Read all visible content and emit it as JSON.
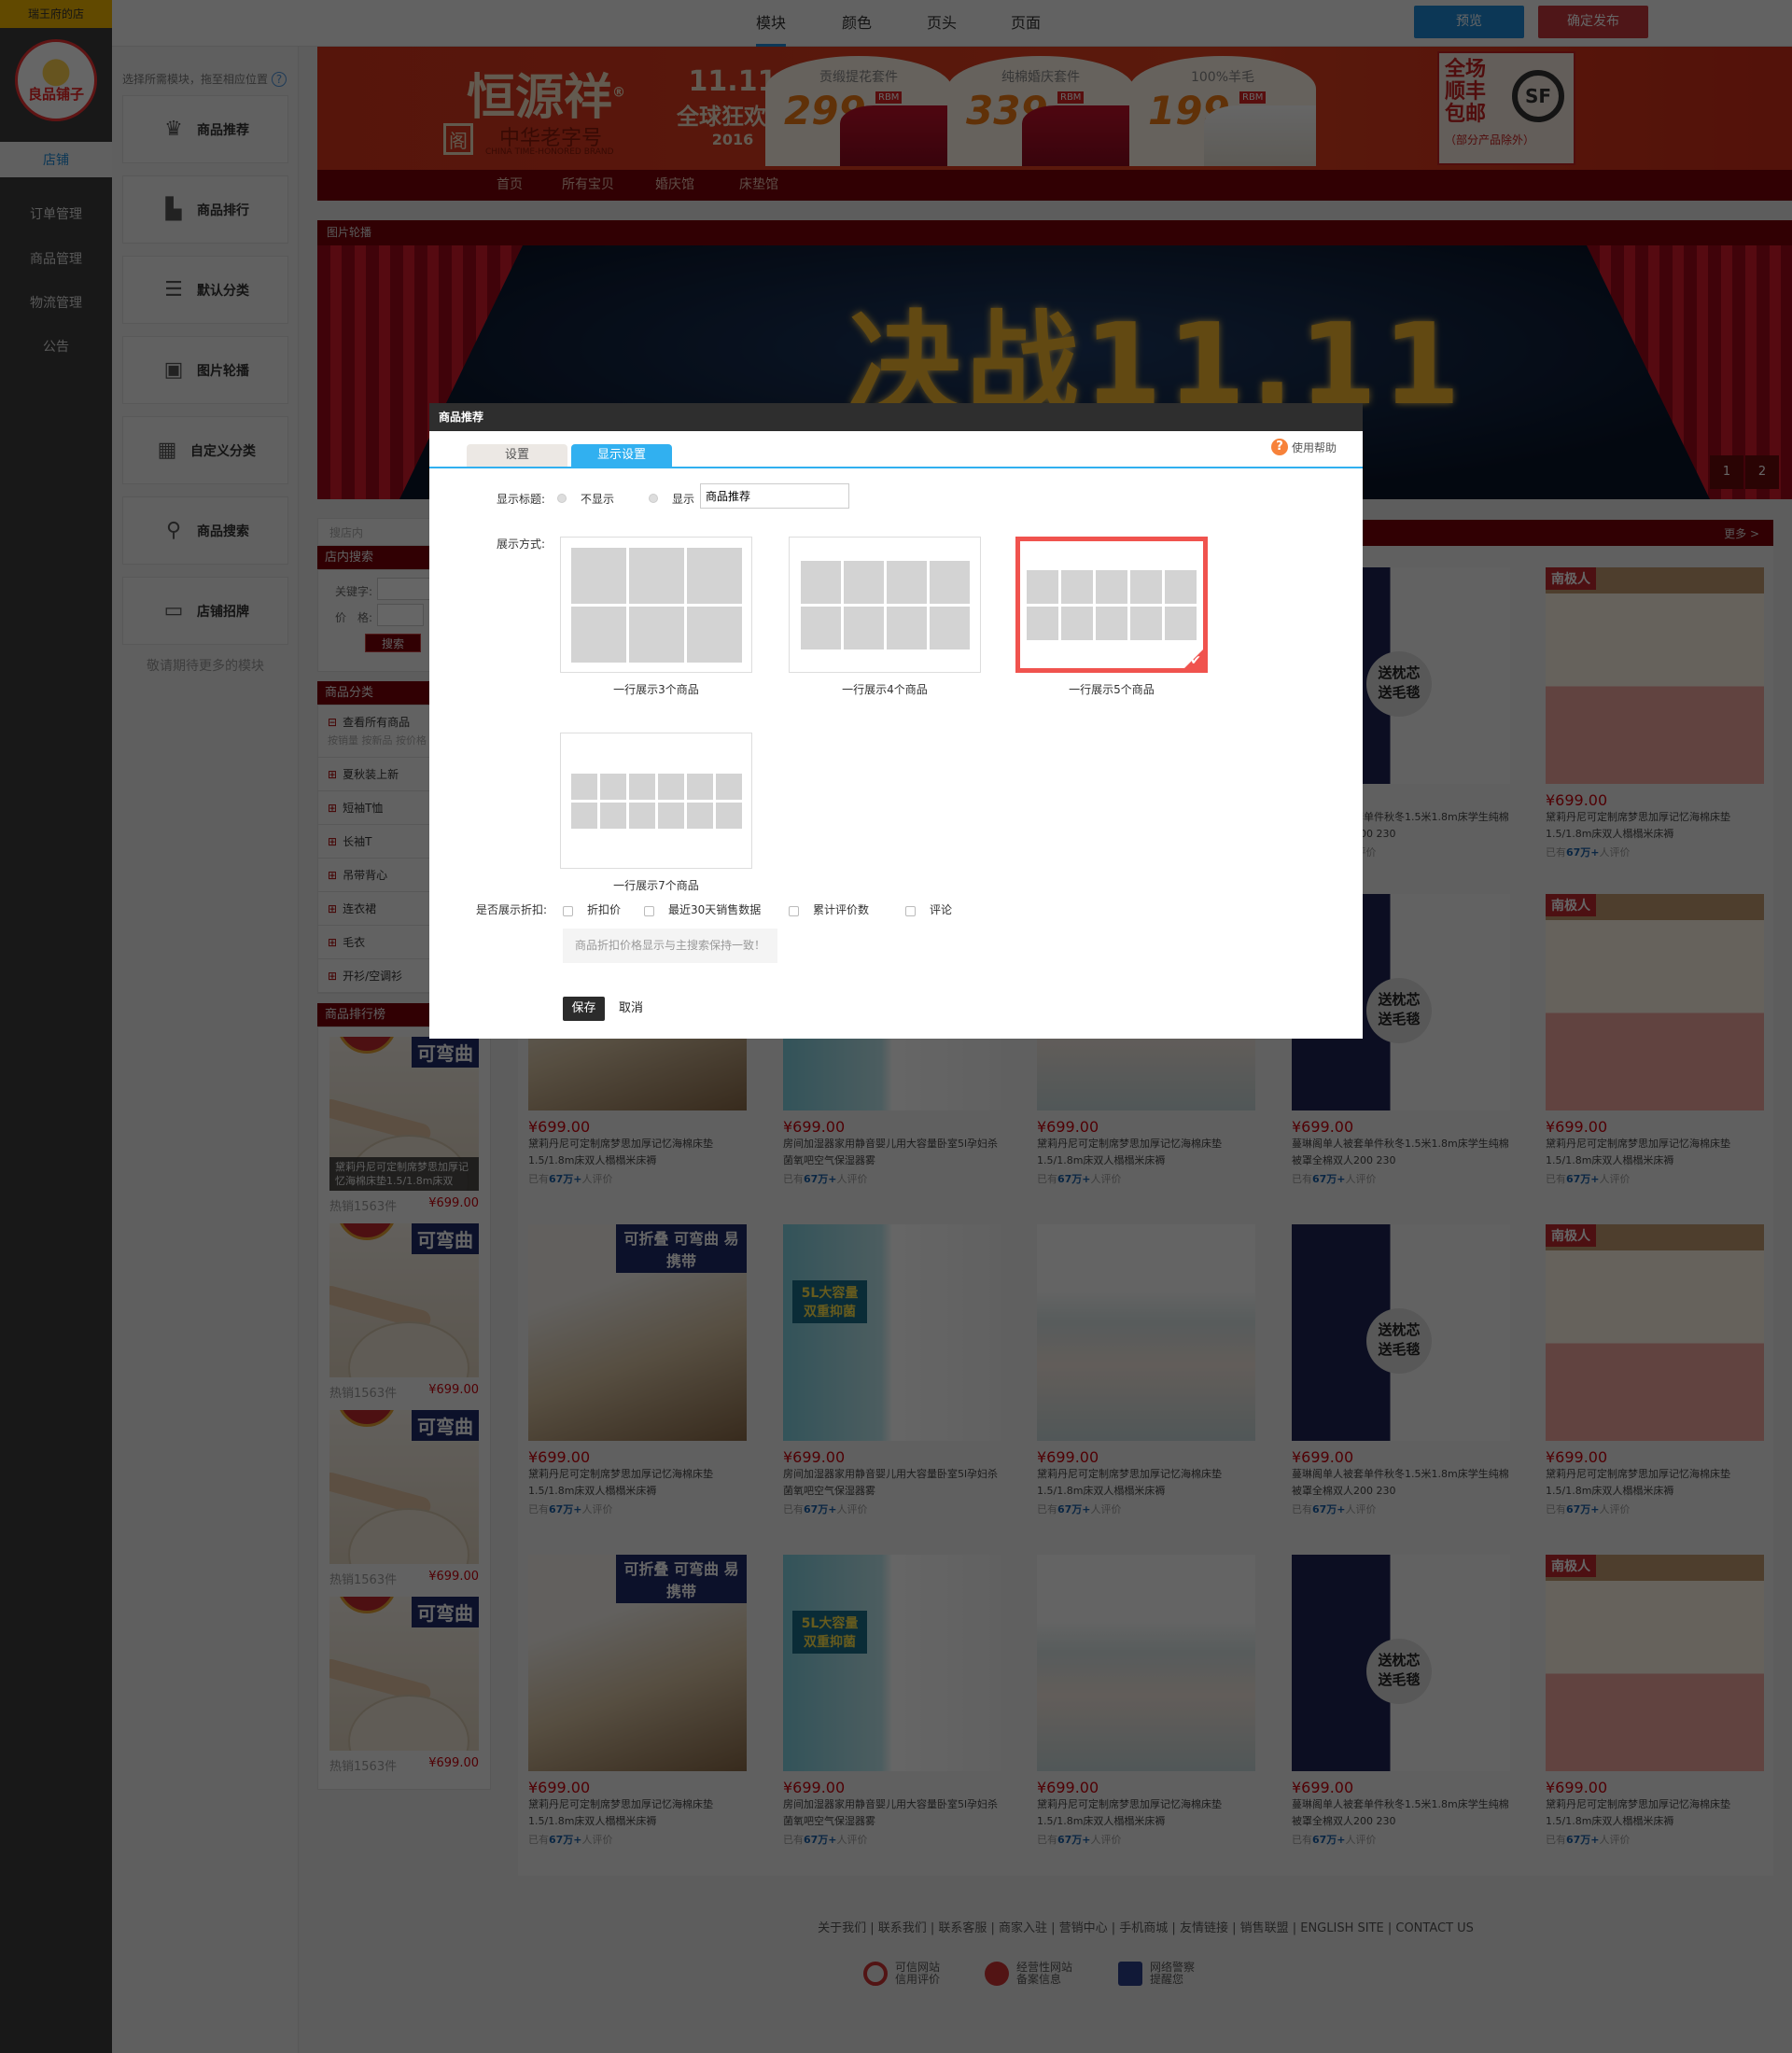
{
  "sidebar": {
    "store_name": "瑞王府的店",
    "logo_text": "良品铺子",
    "items": [
      {
        "label": "店铺"
      },
      {
        "label": "订单管理"
      },
      {
        "label": "商品管理"
      },
      {
        "label": "物流管理"
      },
      {
        "label": "公告"
      }
    ]
  },
  "topbar": {
    "tabs": [
      {
        "label": "模块"
      },
      {
        "label": "颜色"
      },
      {
        "label": "页头"
      },
      {
        "label": "页面"
      }
    ],
    "preview": "预览",
    "publish": "确定发布",
    "accent": "#1e8ad6",
    "publish_color": "#c6383d"
  },
  "modules": {
    "hint": "选择所需模块，拖至相应位置",
    "help_icon": "question-circle-icon",
    "items": [
      {
        "label": "商品推荐",
        "icon": "crown-icon"
      },
      {
        "label": "商品排行",
        "icon": "ranking-icon"
      },
      {
        "label": "默认分类",
        "icon": "list-icon"
      },
      {
        "label": "图片轮播",
        "icon": "image-icon"
      },
      {
        "label": "自定义分类",
        "icon": "grid-icon"
      },
      {
        "label": "商品搜索",
        "icon": "search-icon"
      },
      {
        "label": "店铺招牌",
        "icon": "signboard-icon"
      }
    ],
    "more": "敬请期待更多的模块"
  },
  "header_banner": {
    "brand": "恒源祥",
    "brand_mark": "®",
    "honor": "中华老字号",
    "honor_en": "CHINA TIME-HONORED BRAND",
    "event": "11.11",
    "event_name": "全球狂欢节",
    "event_year": "2016",
    "promos": [
      {
        "title": "贡缎提花套件",
        "price": "299",
        "unit": "RBM"
      },
      {
        "title": "纯棉婚庆套件",
        "price": "339",
        "unit": "RBM"
      },
      {
        "title": "100%羊毛",
        "price": "199",
        "unit": "RBM"
      }
    ],
    "shipping": [
      "全场",
      "顺丰",
      "包邮"
    ],
    "shipping_note": "（部分产品除外）",
    "nav": [
      "首页",
      "所有宝贝",
      "婚庆馆",
      "床垫馆"
    ]
  },
  "carousel": {
    "title": "图片轮播",
    "headline": "决战11.11",
    "pages": [
      "1",
      "2"
    ]
  },
  "search": {
    "placeholder": "搜店内",
    "title": "店内搜索",
    "keyword_label": "关键字:",
    "price_label": "价　格:",
    "button": "搜索"
  },
  "categories": {
    "title": "商品分类",
    "all": "查看所有商品",
    "sort": "按销量  按新品  按价格",
    "items": [
      "夏秋装上新",
      "短袖T恤",
      "长袖T",
      "吊带背心",
      "连衣裙",
      "毛衣",
      "开衫/空调衫"
    ]
  },
  "ranking": {
    "title": "商品排行榜",
    "items": [
      {
        "tag": "可弯曲",
        "caption": "黛莉丹尼可定制席梦思加厚记忆海棉床垫1.5/1.8m床双",
        "sales": "热销1563件",
        "price": "¥699.00"
      },
      {
        "tag": "可弯曲",
        "caption": "",
        "sales": "热销1563件",
        "price": "¥699.00"
      },
      {
        "tag": "可弯曲",
        "caption": "",
        "sales": "热销1563件",
        "price": "¥699.00"
      },
      {
        "tag": "可弯曲",
        "caption": "",
        "sales": "热销1563件",
        "price": "¥699.00"
      }
    ]
  },
  "products": {
    "more": "更多 >",
    "columns": [
      {
        "type": "mattress",
        "badge": "可折叠 可弯曲 易携带",
        "name": "黛莉丹尼可定制席梦思加厚记忆海棉床垫1.5/1.8m床双人榻榻米床褥"
      },
      {
        "type": "humidifier",
        "badge": "5L大容量 双重抑菌",
        "name": "房间加湿器家用静音婴儿用大容量卧室5l孕妇杀菌氧吧空气保湿器雾"
      },
      {
        "type": "bedding-floral",
        "badge": "",
        "name": "黛莉丹尼可定制席梦思加厚记忆海棉床垫1.5/1.8m床双人榻榻米床褥"
      },
      {
        "type": "bedding-stars",
        "badge": "送枕芯 送毛毯",
        "name": "蔓琳阁单人被套单件秋冬1.5米1.8m床学生纯棉被罩全棉双人200 230"
      },
      {
        "type": "bedding-pink",
        "badge": "南极人",
        "name": "黛莉丹尼可定制席梦思加厚记忆海棉床垫1.5/1.8m床双人榻榻米床褥"
      }
    ],
    "price": "¥699.00",
    "review_prefix": "已有",
    "review_count": "67万+",
    "review_suffix": "人评价"
  },
  "footer": {
    "links": "关于我们 | 联系我们 | 联系客服 | 商家入驻 | 营销中心 | 手机商城 | 友情链接 | 销售联盟 | ENGLISH SITE | CONTACT US",
    "badges": [
      {
        "l1": "可信网站",
        "l2": "信用评价"
      },
      {
        "l1": "经营性网站",
        "l2": "备案信息"
      },
      {
        "l1": "网络警察",
        "l2": "提醒您"
      }
    ]
  },
  "modal": {
    "title": "商品推荐",
    "tabs": [
      "设置",
      "显示设置"
    ],
    "active_tab": "显示设置",
    "help": "使用帮助",
    "show_title_label": "显示标题:",
    "opt_hide": "不显示",
    "opt_show": "显示",
    "title_value": "商品推荐",
    "layout_label": "展示方式:",
    "layouts": [
      {
        "label": "一行展示3个商品",
        "per_row": 3,
        "selected": false
      },
      {
        "label": "一行展示4个商品",
        "per_row": 4,
        "selected": false
      },
      {
        "label": "一行展示5个商品",
        "per_row": 5,
        "selected": true
      },
      {
        "label": "一行展示7个商品",
        "per_row": 6,
        "selected": false
      }
    ],
    "discount_label": "是否展示折扣:",
    "checks": [
      "折扣价",
      "最近30天销售数据",
      "累计评价数",
      "评论"
    ],
    "note": "商品折扣价格显示与主搜索保持一致！",
    "save": "保存",
    "cancel": "取消",
    "selected_color": "#f0534e",
    "tab_color": "#31b0f0"
  }
}
